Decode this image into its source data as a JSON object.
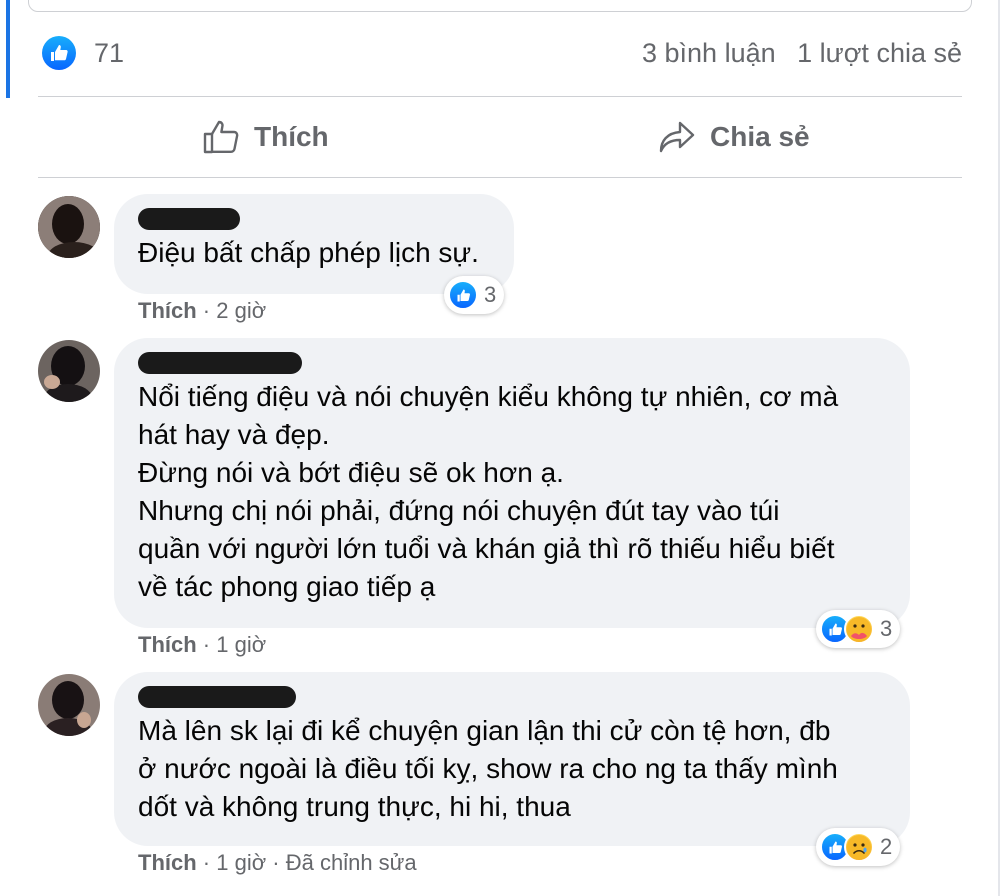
{
  "post": {
    "like_count": "71",
    "comment_count": "3 bình luận",
    "share_count": "1 lượt chia sẻ"
  },
  "actions": {
    "like_label": "Thích",
    "share_label": "Chia sẻ"
  },
  "comments": [
    {
      "text": "Điệu bất chấp phép lịch sự.",
      "like_label": "Thích",
      "time": "2 giờ",
      "edited": "",
      "reactions": [
        "like-icon"
      ],
      "reaction_count": "3"
    },
    {
      "text": "Nổi tiếng điệu và nói chuyện kiểu không tự nhiên, cơ mà\nhát hay và đẹp.\nĐừng nói và bớt điệu sẽ ok hơn ạ.\nNhưng chị nói phải, đứng nói chuyện đút tay vào túi\nquần với người lớn tuổi và khán giả thì rõ thiếu hiểu biết\nvề tác phong giao tiếp ạ",
      "like_label": "Thích",
      "time": "1 giờ",
      "edited": "",
      "reactions": [
        "like-icon",
        "care-icon"
      ],
      "reaction_count": "3"
    },
    {
      "text": "Mà lên sk lại đi kể chuyện gian lận thi cử còn tệ hơn, đb\nở nước ngoài là điều tối kỵ, show ra cho ng ta thấy mình\ndốt và không trung thực, hi hi, thua",
      "like_label": "Thích",
      "time": "1 giờ",
      "edited": "Đã chỉnh sửa",
      "reactions": [
        "like-icon",
        "sad-icon"
      ],
      "reaction_count": "2"
    }
  ],
  "colors": {
    "accent": "#1b74e4",
    "like_blue": "#0866ff",
    "secondary_text": "#65676b",
    "bubble_bg": "#f0f2f5"
  }
}
